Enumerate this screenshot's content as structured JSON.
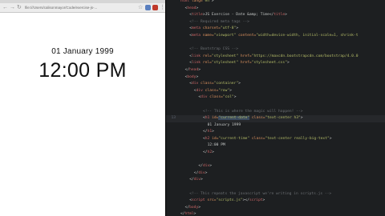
{
  "browser": {
    "url": "file:///Users/calisonmayor/Code/exercise-js-...",
    "date": "01 January 1999",
    "time": "12:00 PM"
  },
  "editor": {
    "lines": [
      {
        "n": "",
        "i": 0,
        "parts": [
          [
            "t",
            "html"
          ],
          [
            "a",
            " lang="
          ],
          [
            "s",
            "\"en\""
          ],
          [
            "p",
            ">"
          ]
        ]
      },
      {
        "n": "",
        "i": 1,
        "parts": [
          [
            "p",
            "<"
          ],
          [
            "t",
            "head"
          ],
          [
            "p",
            ">"
          ]
        ]
      },
      {
        "n": "",
        "i": 2,
        "parts": [
          [
            "p",
            "<"
          ],
          [
            "t",
            "title"
          ],
          [
            "p",
            ">JS Exercise - Date &amp; Time</"
          ],
          [
            "t",
            "title"
          ],
          [
            "p",
            ">"
          ]
        ]
      },
      {
        "n": "",
        "i": 2,
        "parts": [
          [
            "c",
            "<!-- Required meta tags -->"
          ]
        ]
      },
      {
        "n": "",
        "i": 2,
        "parts": [
          [
            "p",
            "<"
          ],
          [
            "t",
            "meta"
          ],
          [
            "a",
            " charset="
          ],
          [
            "s",
            "\"utf-8\""
          ],
          [
            "p",
            ">"
          ]
        ]
      },
      {
        "n": "",
        "i": 2,
        "parts": [
          [
            "p",
            "<"
          ],
          [
            "t",
            "meta"
          ],
          [
            "a",
            " name="
          ],
          [
            "s",
            "\"viewport\""
          ],
          [
            "a",
            " content="
          ],
          [
            "s",
            "\"width=device-width, initial-scale=1, shrink-t"
          ]
        ]
      },
      {
        "n": "",
        "i": 0,
        "parts": []
      },
      {
        "n": "",
        "i": 2,
        "parts": [
          [
            "c",
            "<!-- Bootstrap CSS -->"
          ]
        ]
      },
      {
        "n": "",
        "i": 2,
        "parts": [
          [
            "p",
            "<"
          ],
          [
            "t",
            "link"
          ],
          [
            "a",
            " rel="
          ],
          [
            "s",
            "\"stylesheet\""
          ],
          [
            "a",
            " href="
          ],
          [
            "s",
            "\"https://maxcdn.bootstrapcdn.com/bootstrap/4.0.0"
          ]
        ]
      },
      {
        "n": "",
        "i": 2,
        "parts": [
          [
            "p",
            "<"
          ],
          [
            "t",
            "link"
          ],
          [
            "a",
            " rel="
          ],
          [
            "s",
            "\"stylesheet\""
          ],
          [
            "a",
            " href="
          ],
          [
            "s",
            "\"stylesheet.css\""
          ],
          [
            "p",
            ">"
          ]
        ]
      },
      {
        "n": "",
        "i": 1,
        "parts": [
          [
            "p",
            "</"
          ],
          [
            "t",
            "head"
          ],
          [
            "p",
            ">"
          ]
        ]
      },
      {
        "n": "",
        "i": 1,
        "parts": [
          [
            "p",
            "<"
          ],
          [
            "t",
            "body"
          ],
          [
            "p",
            ">"
          ]
        ]
      },
      {
        "n": "",
        "i": 2,
        "parts": [
          [
            "p",
            "<"
          ],
          [
            "t",
            "div"
          ],
          [
            "a",
            " class="
          ],
          [
            "s",
            "\"container\""
          ],
          [
            "p",
            ">"
          ]
        ]
      },
      {
        "n": "",
        "i": 3,
        "parts": [
          [
            "p",
            "<"
          ],
          [
            "t",
            "div"
          ],
          [
            "a",
            " class="
          ],
          [
            "s",
            "\"row\""
          ],
          [
            "p",
            ">"
          ]
        ]
      },
      {
        "n": "",
        "i": 4,
        "parts": [
          [
            "p",
            "<"
          ],
          [
            "t",
            "div"
          ],
          [
            "a",
            " class="
          ],
          [
            "s",
            "\"col\""
          ],
          [
            "p",
            ">"
          ]
        ]
      },
      {
        "n": "",
        "i": 0,
        "parts": []
      },
      {
        "n": "",
        "i": 5,
        "parts": [
          [
            "c",
            "<!-- This is where the magic will happen! -->"
          ]
        ]
      },
      {
        "n": "13",
        "i": 5,
        "cur": true,
        "parts": [
          [
            "p",
            "<"
          ],
          [
            "t",
            "h1"
          ],
          [
            "a",
            " id="
          ],
          [
            "hl",
            "\"current-date\""
          ],
          [
            "a",
            " class="
          ],
          [
            "s",
            "\"text-center h3\""
          ],
          [
            "p",
            ">"
          ]
        ]
      },
      {
        "n": "",
        "i": 6,
        "parts": [
          [
            "p",
            "01 January 1999"
          ]
        ]
      },
      {
        "n": "",
        "i": 5,
        "parts": [
          [
            "p",
            "</"
          ],
          [
            "t",
            "h1"
          ],
          [
            "p",
            ">"
          ]
        ]
      },
      {
        "n": "",
        "i": 5,
        "parts": [
          [
            "p",
            "<"
          ],
          [
            "t",
            "h2"
          ],
          [
            "a",
            " id="
          ],
          [
            "s",
            "\"current-time\""
          ],
          [
            "a",
            " class="
          ],
          [
            "s",
            "\"text-center really-big-text\""
          ],
          [
            "p",
            ">"
          ]
        ]
      },
      {
        "n": "",
        "i": 6,
        "parts": [
          [
            "p",
            "12:00 PM"
          ]
        ]
      },
      {
        "n": "",
        "i": 5,
        "parts": [
          [
            "p",
            "</"
          ],
          [
            "t",
            "h2"
          ],
          [
            "p",
            ">"
          ]
        ]
      },
      {
        "n": "",
        "i": 0,
        "parts": []
      },
      {
        "n": "",
        "i": 4,
        "parts": [
          [
            "p",
            "</"
          ],
          [
            "t",
            "div"
          ],
          [
            "p",
            ">"
          ]
        ]
      },
      {
        "n": "",
        "i": 3,
        "parts": [
          [
            "p",
            "</"
          ],
          [
            "t",
            "div"
          ],
          [
            "p",
            ">"
          ]
        ]
      },
      {
        "n": "",
        "i": 2,
        "parts": [
          [
            "p",
            "</"
          ],
          [
            "t",
            "div"
          ],
          [
            "p",
            ">"
          ]
        ]
      },
      {
        "n": "",
        "i": 0,
        "parts": []
      },
      {
        "n": "",
        "i": 2,
        "parts": [
          [
            "c",
            "<!-- This repeats the javascript we're writing in scripts.js -->"
          ]
        ]
      },
      {
        "n": "",
        "i": 2,
        "parts": [
          [
            "p",
            "<"
          ],
          [
            "t",
            "script"
          ],
          [
            "a",
            " src="
          ],
          [
            "s",
            "\"scripts.js\""
          ],
          [
            "p",
            "></"
          ],
          [
            "t",
            "script"
          ],
          [
            "p",
            ">"
          ]
        ]
      },
      {
        "n": "",
        "i": 1,
        "parts": [
          [
            "p",
            "</"
          ],
          [
            "t",
            "body"
          ],
          [
            "p",
            ">"
          ]
        ]
      },
      {
        "n": "",
        "i": 0,
        "parts": [
          [
            "p",
            "</"
          ],
          [
            "t",
            "html"
          ],
          [
            "p",
            ">"
          ]
        ]
      }
    ]
  }
}
